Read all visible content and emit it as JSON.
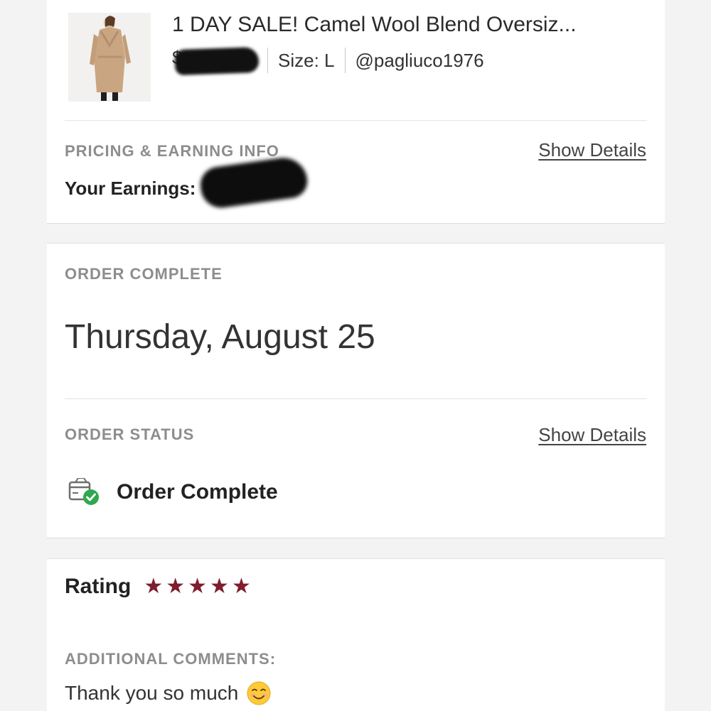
{
  "item": {
    "title": "1 DAY SALE! Camel Wool Blend Oversiz...",
    "price_visible": "$",
    "size": "Size: L",
    "seller": "@pagliuco1976"
  },
  "pricing": {
    "label": "PRICING & EARNING INFO",
    "show_details": "Show Details",
    "earnings_label": "Your Earnings:"
  },
  "order": {
    "complete_label": "ORDER COMPLETE",
    "date": "Thursday, August 25",
    "status_label": "ORDER STATUS",
    "show_details": "Show Details",
    "status_text": "Order Complete"
  },
  "rating": {
    "label": "Rating",
    "stars": 5,
    "comments_label": "ADDITIONAL COMMENTS:",
    "comment": "Thank you so much"
  },
  "colors": {
    "star": "#7e1e2f",
    "check_green": "#2fa84f",
    "label_grey": "#8d8d8d"
  }
}
